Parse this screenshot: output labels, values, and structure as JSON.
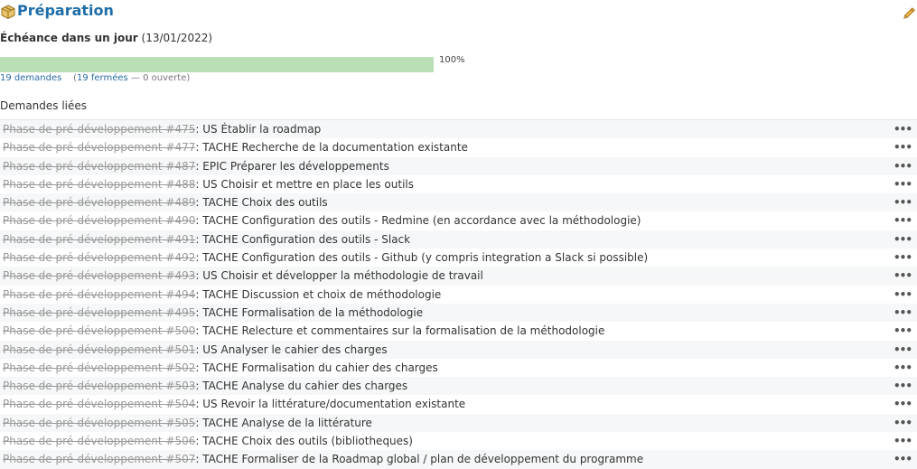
{
  "header": {
    "title": "Préparation"
  },
  "due": {
    "label": "Échéance dans un  jour",
    "date": "(13/01/2022)"
  },
  "progress": {
    "percent_label": "100%",
    "percent": 100
  },
  "counts": {
    "total": "19 demandes",
    "open_paren": "(",
    "closed": "19 fermées",
    "rest": " — 0 ouverte)"
  },
  "related": {
    "title": "Demandes liées",
    "issues": [
      {
        "ref": "Phase de pré-développement #475",
        "subject": ": US Établir la roadmap"
      },
      {
        "ref": "Phase de pré-développement #477",
        "subject": ": TACHE Recherche de la documentation existante"
      },
      {
        "ref": "Phase de pré-développement #487",
        "subject": ": EPIC Préparer les développements"
      },
      {
        "ref": "Phase de pré-développement #488",
        "subject": ": US Choisir et mettre en place les outils"
      },
      {
        "ref": "Phase de pré-développement #489",
        "subject": ": TACHE Choix des outils"
      },
      {
        "ref": "Phase de pré-développement #490",
        "subject": ": TACHE Configuration des outils - Redmine (en accordance avec la méthodologie)"
      },
      {
        "ref": "Phase de pré-développement #491",
        "subject": ": TACHE Configuration des outils - Slack"
      },
      {
        "ref": "Phase de pré-développement #492",
        "subject": ": TACHE Configuration des outils - Github (y compris integration a Slack si possible)"
      },
      {
        "ref": "Phase de pré-développement #493",
        "subject": ": US Choisir et développer la méthodologie de travail"
      },
      {
        "ref": "Phase de pré-développement #494",
        "subject": ": TACHE Discussion et choix de méthodologie"
      },
      {
        "ref": "Phase de pré-développement #495",
        "subject": ": TACHE Formalisation de la méthodologie"
      },
      {
        "ref": "Phase de pré-développement #500",
        "subject": ": TACHE Relecture et commentaires sur la formalisation de la méthodologie"
      },
      {
        "ref": "Phase de pré-développement #501",
        "subject": ": US Analyser le cahier des charges"
      },
      {
        "ref": "Phase de pré-développement #502",
        "subject": ": TACHE Formalisation du cahier des charges"
      },
      {
        "ref": "Phase de pré-développement #503",
        "subject": ": TACHE Analyse du cahier des charges"
      },
      {
        "ref": "Phase de pré-développement #504",
        "subject": ": US Revoir la littérature/documentation existante"
      },
      {
        "ref": "Phase de pré-développement #505",
        "subject": ": TACHE Analyse de la littérature"
      },
      {
        "ref": "Phase de pré-développement #506",
        "subject": ": TACHE Choix des outils (bibliotheques)"
      },
      {
        "ref": "Phase de pré-développement #507",
        "subject": ": TACHE Formaliser de la Roadmap global / plan de développement du programme"
      }
    ]
  },
  "icons": {
    "title_icon": "package-icon",
    "edit_icon": "pencil-icon",
    "row_menu_icon": "ellipsis-icon"
  },
  "colors": {
    "title": "#1d6ea8",
    "progress_fill": "#badfb6",
    "link": "#2a6ba5"
  }
}
